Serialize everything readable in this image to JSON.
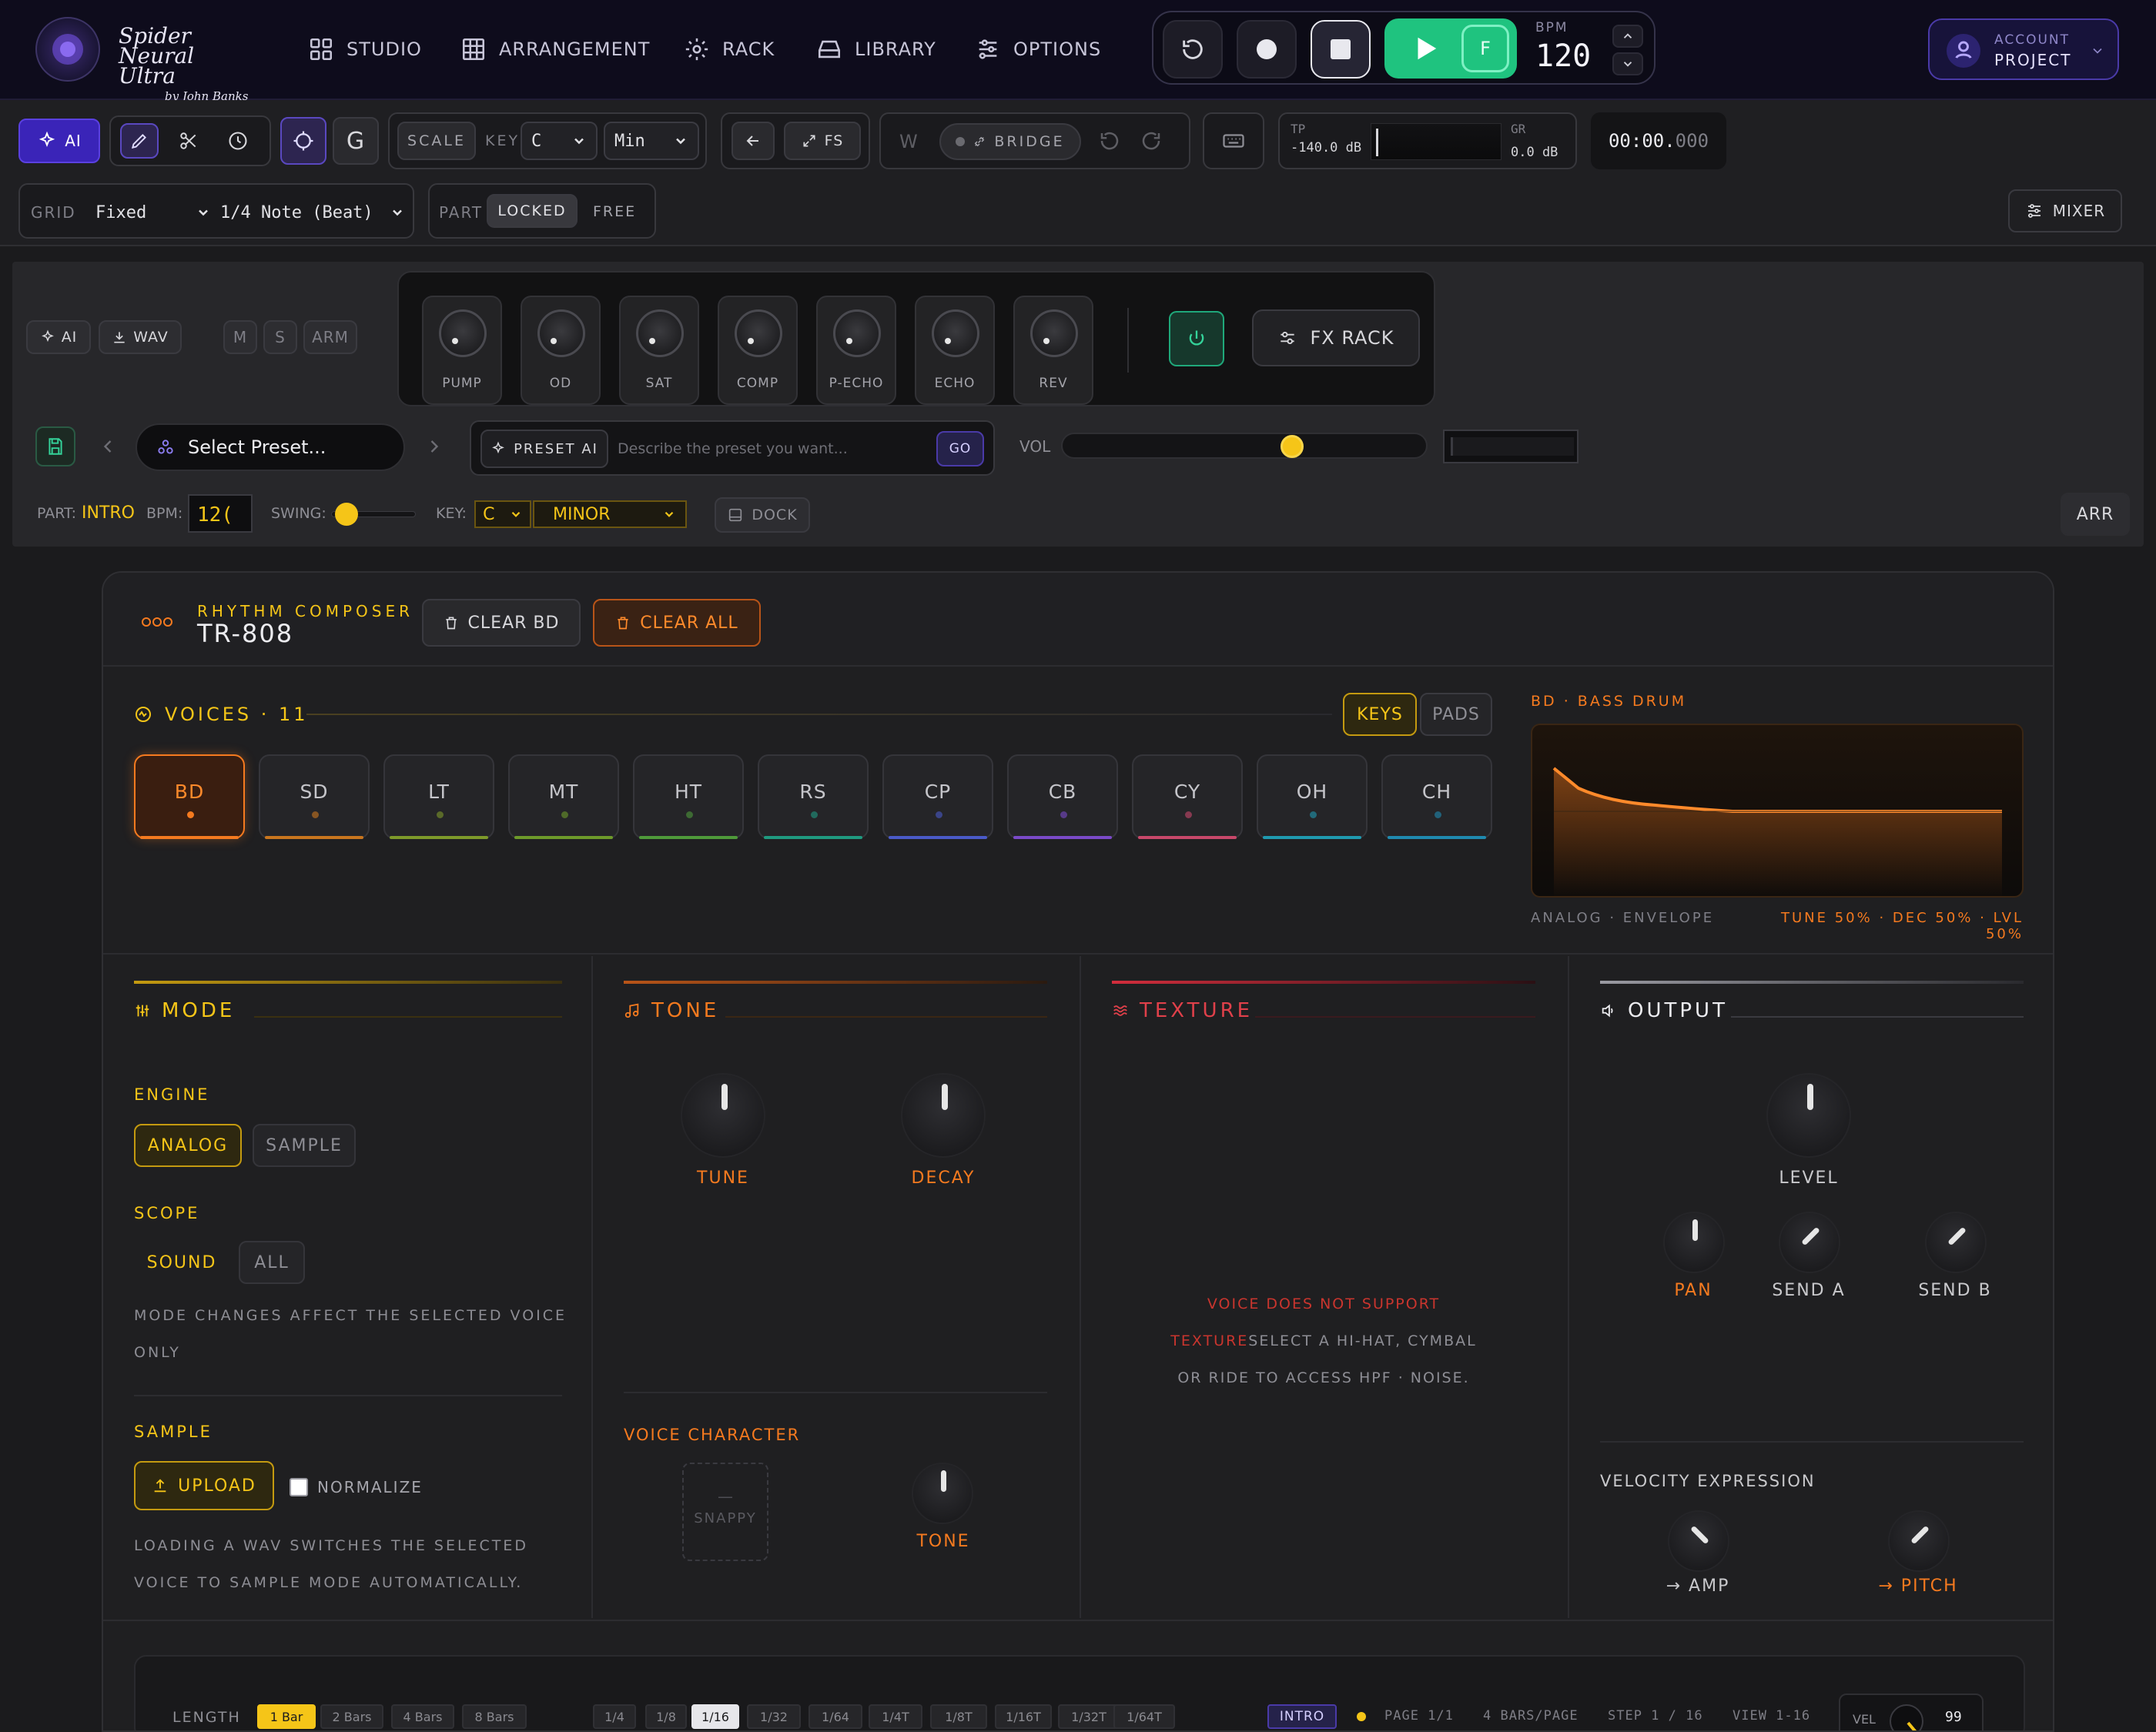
{
  "nav": {
    "signature_line1": "Spider Neural Ultra",
    "signature_line2": "by John Banks",
    "items": [
      {
        "label": "STUDIO",
        "icon": "grid-icon"
      },
      {
        "label": "ARRANGEMENT",
        "icon": "table-icon"
      },
      {
        "label": "RACK",
        "icon": "gear-icon"
      },
      {
        "label": "LIBRARY",
        "icon": "drive-icon"
      },
      {
        "label": "OPTIONS",
        "icon": "sliders-icon"
      }
    ],
    "follow_label": "F",
    "bpm_label": "BPM",
    "bpm_value": "120",
    "account_label": "ACCOUNT",
    "project_label": "PROJECT"
  },
  "toolbar": {
    "ai_label": "AI",
    "g_label": "G",
    "scale_label": "SCALE",
    "key_label": "KEY",
    "key_value": "C",
    "mode_value": "Min",
    "fs_label": "FS",
    "w_label": "W",
    "bridge_label": "BRIDGE",
    "tp_label": "TP",
    "tp_value": "-140.0 dB",
    "gr_label": "GR",
    "gr_value": "0.0 dB",
    "time_main": "00:00.",
    "time_ms": "000",
    "grid_label": "GRID",
    "grid_value": "Fixed",
    "note_value": "1/4 Note (Beat)",
    "part_label": "PART",
    "locked_label": "LOCKED",
    "free_label": "FREE",
    "mixer_label": "MIXER"
  },
  "rack": {
    "ai_label": "AI",
    "wav_label": "WAV",
    "m_label": "M",
    "s_label": "S",
    "arm_label": "ARM",
    "knobs": [
      "PUMP",
      "OD",
      "SAT",
      "COMP",
      "P-ECHO",
      "ECHO",
      "REV"
    ],
    "fx_rack_label": "FX RACK",
    "preset_placeholder": "Select Preset...",
    "preset_ai_label": "PRESET AI",
    "preset_ai_placeholder": "Describe the preset you want...",
    "go_label": "GO",
    "vol_label": "VOL",
    "vol_fraction": 0.64,
    "part_label": "PART:",
    "part_value": "INTRO",
    "bpm_label": "BPM:",
    "bpm_value": "12(",
    "swing_label": "SWING:",
    "key_label": "KEY:",
    "key_value": "C",
    "key_mode": "MINOR",
    "dock_label": "DOCK",
    "arr_label": "ARR"
  },
  "composer": {
    "subtitle": "RHYTHM COMPOSER",
    "title": "TR-808",
    "clear_bd_label": "CLEAR BD",
    "clear_all_label": "CLEAR ALL",
    "voices_label": "VOICES · 11",
    "keys_label": "KEYS",
    "pads_label": "PADS",
    "voices": [
      {
        "name": "BD",
        "color": "#f57a1f"
      },
      {
        "name": "SD",
        "color": "#c9761e"
      },
      {
        "name": "LT",
        "color": "#7e9a2a"
      },
      {
        "name": "MT",
        "color": "#6d9a2a"
      },
      {
        "name": "HT",
        "color": "#4f9a3a"
      },
      {
        "name": "RS",
        "color": "#1f9a80"
      },
      {
        "name": "CP",
        "color": "#4a5ac8"
      },
      {
        "name": "CB",
        "color": "#7a4ac8"
      },
      {
        "name": "CY",
        "color": "#c8486a"
      },
      {
        "name": "OH",
        "color": "#1f9ab0"
      },
      {
        "name": "CH",
        "color": "#1f8ab0"
      }
    ],
    "env_title": "BD · BASS DRUM",
    "env_caption_left": "ANALOG · ENVELOPE",
    "env_caption_right": "TUNE 50% · DEC 50% · LVL 50%",
    "mode": {
      "title": "MODE",
      "engine_label": "ENGINE",
      "analog_label": "ANALOG",
      "sample_label": "SAMPLE",
      "scope_label": "SCOPE",
      "sound_label": "SOUND",
      "all_label": "ALL",
      "scope_note_1": "MODE CHANGES AFFECT THE SELECTED VOICE",
      "scope_note_2": "ONLY",
      "sample_title": "SAMPLE",
      "upload_label": "UPLOAD",
      "normalize_label": "NORMALIZE",
      "sample_note_1": "LOADING A WAV SWITCHES THE SELECTED",
      "sample_note_2": "VOICE TO SAMPLE MODE AUTOMATICALLY."
    },
    "tone": {
      "title": "TONE",
      "tune_label": "TUNE",
      "decay_label": "DECAY",
      "character_label": "VOICE CHARACTER",
      "snappy_label": "SNAPPY",
      "tone_label": "TONE"
    },
    "texture": {
      "title": "TEXTURE",
      "msg_1": "VOICE DOES NOT SUPPORT",
      "msg_2a": "TEXTURE",
      "msg_2b": "SELECT A HI-HAT, CYMBAL",
      "msg_3": "OR RIDE TO ACCESS HPF · NOISE."
    },
    "output": {
      "title": "OUTPUT",
      "level_label": "LEVEL",
      "pan_label": "PAN",
      "send_a_label": "SEND A",
      "send_b_label": "SEND B",
      "velocity_label": "VELOCITY EXPRESSION",
      "amp_label": "→ AMP",
      "pitch_label": "→ PITCH"
    },
    "sequencer": {
      "length_label": "LENGTH",
      "lengths": [
        "1 Bar",
        "2 Bars",
        "4 Bars",
        "8 Bars"
      ],
      "divisions": [
        "1/4",
        "1/8",
        "1/16",
        "1/32",
        "1/64",
        "1/4T",
        "1/8T",
        "1/16T",
        "1/32T",
        "1/64T"
      ],
      "part_value": "INTRO",
      "page_label": "PAGE 1/1",
      "bars_label": "4 BARS/PAGE",
      "step_label": "STEP 1 / 16",
      "view_label": "VIEW 1-16",
      "vel_label": "VEL",
      "vel_value": "99"
    }
  }
}
